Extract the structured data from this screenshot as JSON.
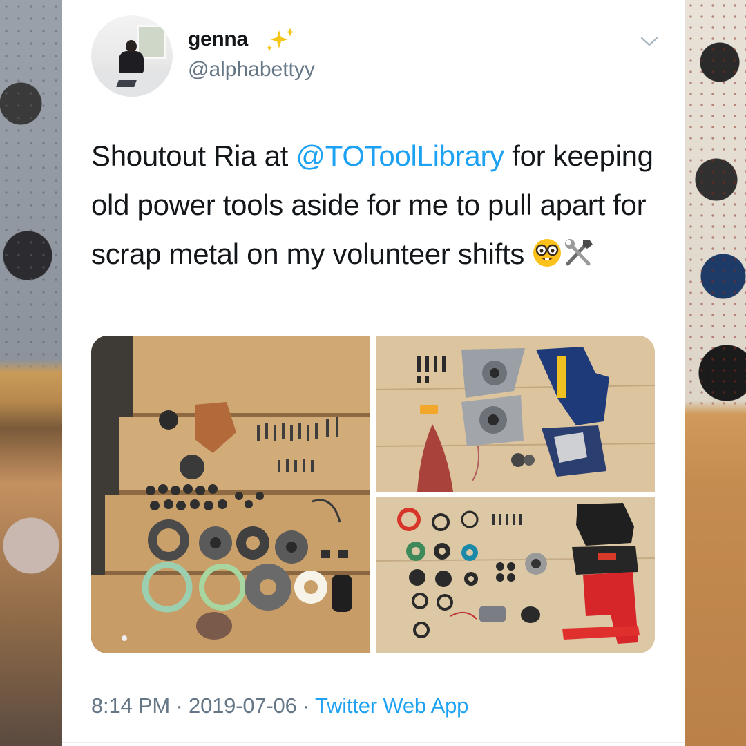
{
  "tweet": {
    "display_name": "genna",
    "name_emoji": "sparkles",
    "handle": "@alphabettyy",
    "text_parts": {
      "before_mention": "Shoutout Ria at ",
      "mention": "@TOToolLibrary",
      "after_mention": " for keeping old power tools aside for me to pull apart for scrap metal on my volunteer shifts",
      "emojis": [
        "nerd-face",
        "hammer-and-wrench"
      ]
    },
    "photos": [
      {
        "name": "disassembled-tool-parts-on-wood-steps"
      },
      {
        "name": "disassembled-ryobi-sander"
      },
      {
        "name": "disassembled-red-drill"
      }
    ],
    "time": "8:14 PM",
    "separator": "·",
    "date": "2019-07-06",
    "source": "Twitter Web App"
  },
  "colors": {
    "link": "#1da1f2",
    "text": "#14171a",
    "secondary": "#657786",
    "card_bg": "#ffffff"
  },
  "icons": {
    "menu": "chevron-down-icon",
    "name_emoji": "sparkles-icon"
  }
}
